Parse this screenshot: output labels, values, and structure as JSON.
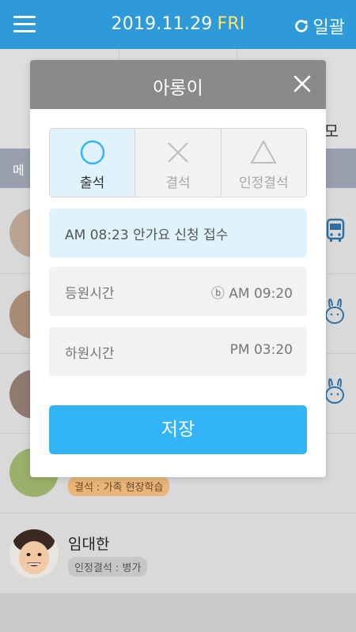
{
  "header": {
    "date": "2019.11.29",
    "day": "FRI",
    "refresh_label": "일괄"
  },
  "background": {
    "tab_partial_label": "모",
    "section_partial_label": "메",
    "absence_badge": "결석 : 가족 현장학습",
    "last_child_name": "임대한",
    "last_child_badge": "인정결석 : 병가"
  },
  "modal": {
    "title": "아롱이",
    "options": [
      {
        "label": "출석",
        "icon": "circle-icon",
        "selected": true
      },
      {
        "label": "결석",
        "icon": "x-mark-icon",
        "selected": false
      },
      {
        "label": "인정결석",
        "icon": "triangle-icon",
        "selected": false
      }
    ],
    "notice": "AM 08:23  안가요 신청 접수",
    "arrival": {
      "label": "등원시간",
      "value": "ⓑ AM 09:20"
    },
    "departure": {
      "label": "하원시간",
      "value": "PM 03:20"
    },
    "save_label": "저장"
  },
  "colors": {
    "header": "#2e9ad9",
    "accent": "#33b5f5",
    "day_highlight": "#ffe36b",
    "selected_bg": "#e0f3fd"
  }
}
